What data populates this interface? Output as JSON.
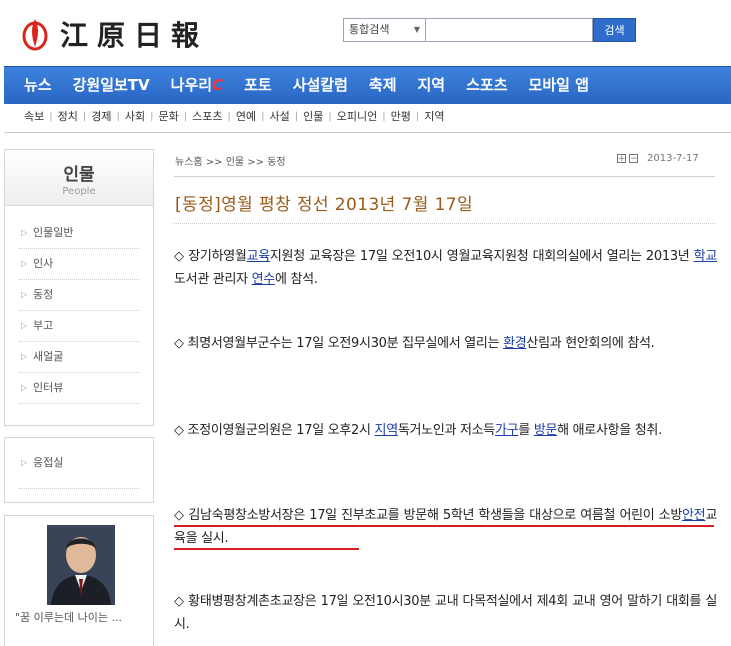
{
  "brand": {
    "logo_text": "江原日報",
    "accent": "#2f6dcc"
  },
  "search": {
    "select_label": "통합검색",
    "button_label": "검색",
    "placeholder": ""
  },
  "nav": [
    "뉴스",
    "강원일보TV",
    "나우리",
    "포토",
    "사설칼럼",
    "축제",
    "지역",
    "스포츠",
    "모바일 앱"
  ],
  "nav_now_suffix": "C",
  "subnav": [
    "속보",
    "정치",
    "경제",
    "사회",
    "문화",
    "스포츠",
    "연예",
    "사설",
    "인물",
    "오피니언",
    "만평",
    "지역"
  ],
  "sidebar": {
    "title": "인물",
    "title_en": "People",
    "items": [
      "인물일반",
      "인사",
      "동정",
      "부고",
      "새얼굴",
      "인터뷰"
    ],
    "items2": [
      "응접실"
    ],
    "quote": "\"꿈 이루는데 나이는 ..."
  },
  "article": {
    "breadcrumb": "뉴스홈 >> 인물 >> 동정",
    "date": "2013-7-17",
    "title": "[동정]영월 평창 정선 2013년 7월 17일",
    "p1": {
      "t1": "◇ 장기하영월",
      "k1": "교육",
      "t2": "지원청 교육장은 17일 오전10시 영월교육지원청 대회의실에서 열리는 2013년 ",
      "k2": "학교",
      "t3": "도서관 관리자 ",
      "k3": "연수",
      "t4": "에 참석."
    },
    "p2": {
      "t1": "◇ 최명서영월부군수는 17일 오전9시30분 집무실에서 열리는 ",
      "k1": "환경",
      "t2": "산림과 현안회의에 참석."
    },
    "p3": {
      "t1": "◇ 조정이영월군의원은 17일 오후2시 ",
      "k1": "지역",
      "t2": "독거노인과 저소득",
      "k2": "가구",
      "t3": "를 ",
      "k3": "방문",
      "t4": "해 애로사항을 청취."
    },
    "p4": {
      "t1": "◇ 김남숙평창소방서장은 17일 진부초교를 방문해 5학년 학생들을 대상으로 여름철 어린이 소방",
      "k1": "안전",
      "t2": "교육을 실시."
    },
    "p5": {
      "t1": "◇ 황태병평창계촌초교장은 17일 오전10시30분 교내 다목적실에서 제4회 교내 영어 말하기 대회를 실시."
    }
  }
}
